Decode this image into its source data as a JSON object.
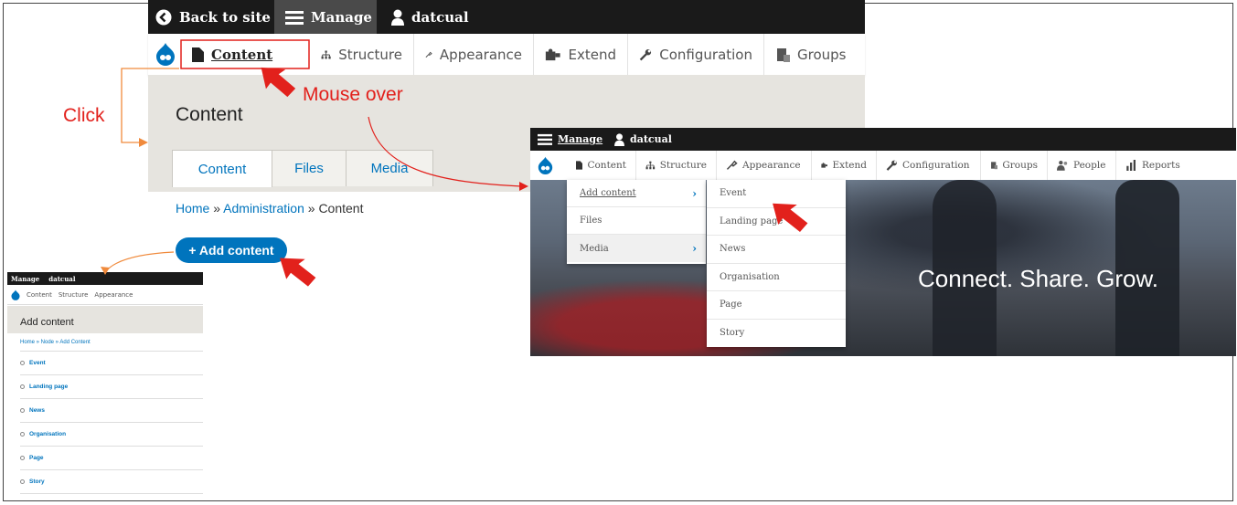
{
  "main": {
    "topbar": {
      "back": "Back to site",
      "manage": "Manage",
      "user": "datcual"
    },
    "toolbar": {
      "content": "Content",
      "structure": "Structure",
      "appearance": "Appearance",
      "extend": "Extend",
      "configuration": "Configuration",
      "groups": "Groups"
    },
    "page_title": "Content",
    "tabs": [
      "Content",
      "Files",
      "Media"
    ],
    "breadcrumb": {
      "home": "Home",
      "sep": " » ",
      "admin": "Administration",
      "current": "Content"
    },
    "add_button": "+ Add content"
  },
  "annotations": {
    "click": "Click",
    "mouse_over": "Mouse over"
  },
  "mini": {
    "topbar": {
      "manage": "Manage",
      "user": "datcual"
    },
    "toolbar": {
      "content": "Content",
      "structure": "Structure",
      "appearance": "Appearance"
    },
    "title": "Add content",
    "breadcrumb": "Home » Node » Add Content",
    "items": [
      "Event",
      "Landing page",
      "News",
      "Organisation",
      "Page",
      "Story"
    ]
  },
  "dropdown_shot": {
    "topbar": {
      "manage": "Manage",
      "user": "datcual"
    },
    "toolbar": {
      "content": "Content",
      "structure": "Structure",
      "appearance": "Appearance",
      "extend": "Extend",
      "configuration": "Configuration",
      "groups": "Groups",
      "people": "People",
      "reports": "Reports"
    },
    "menu1": [
      "Add content",
      "Files",
      "Media"
    ],
    "menu2": [
      "Event",
      "Landing page",
      "News",
      "Organisation",
      "Page",
      "Story"
    ],
    "hero_text": "Connect. Share. Grow."
  },
  "colors": {
    "link": "#0074bd",
    "annotation": "#e2211c",
    "toolbar_dark": "#1a1a1a"
  }
}
